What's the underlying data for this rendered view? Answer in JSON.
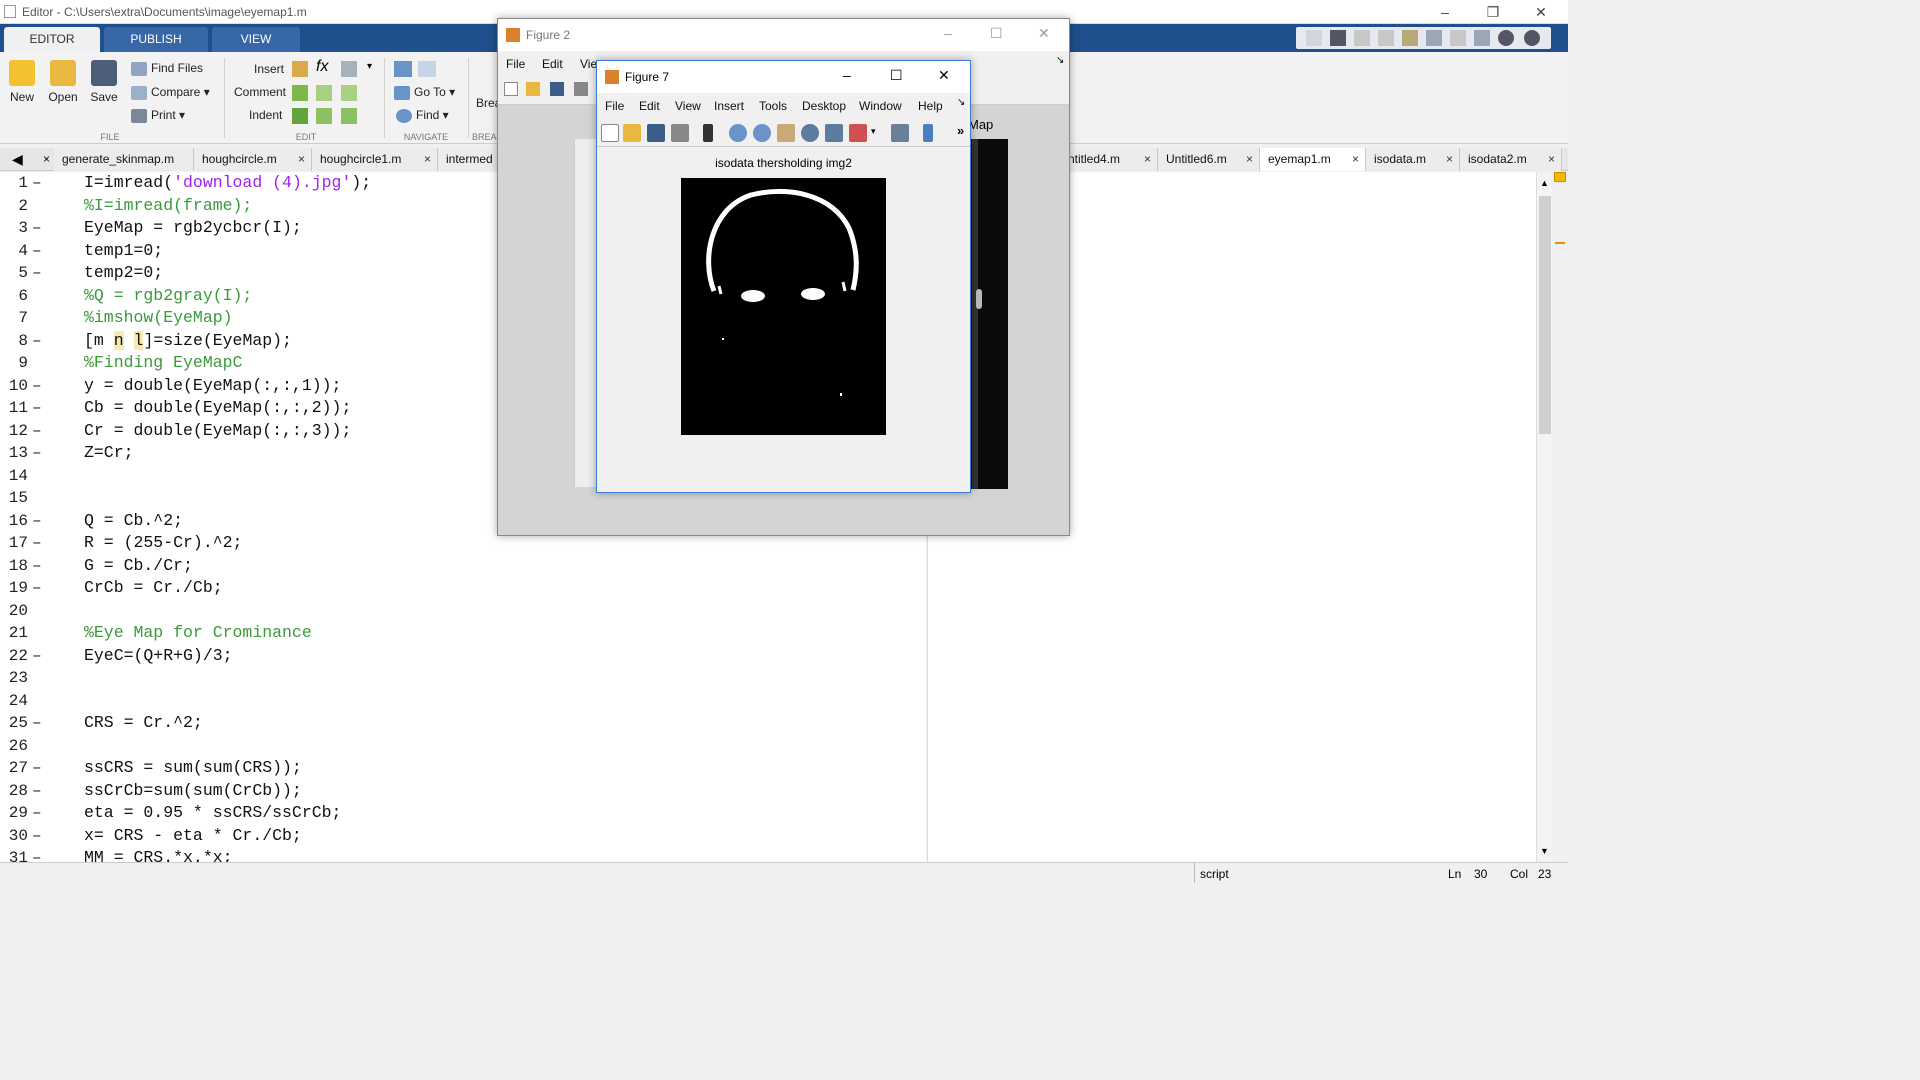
{
  "window": {
    "title": "Editor - C:\\Users\\extra\\Documents\\image\\eyemap1.m"
  },
  "ribbon_tabs": [
    {
      "label": "EDITOR"
    },
    {
      "label": "PUBLISH"
    },
    {
      "label": "VIEW"
    }
  ],
  "ribbon": {
    "new": "New",
    "open": "Open",
    "save": "Save",
    "find_files": "Find Files",
    "compare": "Compare",
    "print": "Print",
    "insert": "Insert",
    "comment": "Comment",
    "indent": "Indent",
    "fx": "fx",
    "go_to": "Go To",
    "find": "Find",
    "breakpoints": "Brea",
    "sections": {
      "file": "FILE",
      "edit": "EDIT",
      "navigate": "NAVIGATE",
      "breakpoints": "BREA"
    }
  },
  "file_tabs": [
    {
      "label": "generate_skinmap.m"
    },
    {
      "label": "houghcircle.m"
    },
    {
      "label": "houghcircle1.m"
    },
    {
      "label": "intermed"
    },
    {
      "label": "ntitled4.m"
    },
    {
      "label": "Untitled6.m"
    },
    {
      "label": "eyemap1.m"
    },
    {
      "label": "isodata.m"
    },
    {
      "label": "isodata2.m"
    }
  ],
  "close_glyph": "×",
  "code_lines": [
    {
      "n": "1",
      "dash": "–",
      "segs": [
        {
          "t": "I=imread(",
          "c": ""
        },
        {
          "t": "'download (4).jpg'",
          "c": "st"
        },
        {
          "t": ");",
          "c": ""
        }
      ]
    },
    {
      "n": "2",
      "dash": "",
      "segs": [
        {
          "t": "%I=imread(frame);",
          "c": "cm"
        }
      ]
    },
    {
      "n": "3",
      "dash": "–",
      "segs": [
        {
          "t": "EyeMap = rgb2ycbcr(I);",
          "c": ""
        }
      ]
    },
    {
      "n": "4",
      "dash": "–",
      "segs": [
        {
          "t": "temp1=0;",
          "c": ""
        }
      ]
    },
    {
      "n": "5",
      "dash": "–",
      "segs": [
        {
          "t": "temp2=0;",
          "c": ""
        }
      ]
    },
    {
      "n": "6",
      "dash": "",
      "segs": [
        {
          "t": "%Q = rgb2gray(I);",
          "c": "cm"
        }
      ]
    },
    {
      "n": "7",
      "dash": "",
      "segs": [
        {
          "t": "%imshow(EyeMap)",
          "c": "cm"
        }
      ]
    },
    {
      "n": "8",
      "dash": "–",
      "segs": [
        {
          "t": "[m ",
          "c": ""
        },
        {
          "t": "n",
          "c": "hl"
        },
        {
          "t": " ",
          "c": ""
        },
        {
          "t": "l",
          "c": "hl"
        },
        {
          "t": "]=size(EyeMap);",
          "c": ""
        }
      ]
    },
    {
      "n": "9",
      "dash": "",
      "segs": [
        {
          "t": "%Finding EyeMapC",
          "c": "cm"
        }
      ]
    },
    {
      "n": "10",
      "dash": "–",
      "segs": [
        {
          "t": "y = double(EyeMap(:,:,1));",
          "c": ""
        }
      ]
    },
    {
      "n": "11",
      "dash": "–",
      "segs": [
        {
          "t": "Cb = double(EyeMap(:,:,2));",
          "c": ""
        }
      ]
    },
    {
      "n": "12",
      "dash": "–",
      "segs": [
        {
          "t": "Cr = double(EyeMap(:,:,3));",
          "c": ""
        }
      ]
    },
    {
      "n": "13",
      "dash": "–",
      "segs": [
        {
          "t": "Z=Cr;",
          "c": ""
        }
      ]
    },
    {
      "n": "14",
      "dash": "",
      "segs": []
    },
    {
      "n": "15",
      "dash": "",
      "segs": []
    },
    {
      "n": "16",
      "dash": "–",
      "segs": [
        {
          "t": "Q = Cb.^2;",
          "c": ""
        }
      ]
    },
    {
      "n": "17",
      "dash": "–",
      "segs": [
        {
          "t": "R = (255-Cr).^2;",
          "c": ""
        }
      ]
    },
    {
      "n": "18",
      "dash": "–",
      "segs": [
        {
          "t": "G = Cb./Cr;",
          "c": ""
        }
      ]
    },
    {
      "n": "19",
      "dash": "–",
      "segs": [
        {
          "t": "CrCb = Cr./Cb;",
          "c": ""
        }
      ]
    },
    {
      "n": "20",
      "dash": "",
      "segs": []
    },
    {
      "n": "21",
      "dash": "",
      "segs": [
        {
          "t": "%Eye Map for Crominance",
          "c": "cm"
        }
      ]
    },
    {
      "n": "22",
      "dash": "–",
      "segs": [
        {
          "t": "EyeC=(Q+R+G)/3;",
          "c": ""
        }
      ]
    },
    {
      "n": "23",
      "dash": "",
      "segs": []
    },
    {
      "n": "24",
      "dash": "",
      "segs": []
    },
    {
      "n": "25",
      "dash": "–",
      "segs": [
        {
          "t": "CRS = Cr.^2;",
          "c": ""
        }
      ]
    },
    {
      "n": "26",
      "dash": "",
      "segs": []
    },
    {
      "n": "27",
      "dash": "–",
      "segs": [
        {
          "t": "ssCRS = sum(sum(CRS));",
          "c": ""
        }
      ]
    },
    {
      "n": "28",
      "dash": "–",
      "segs": [
        {
          "t": "ssCrCb=sum(sum(CrCb));",
          "c": ""
        }
      ]
    },
    {
      "n": "29",
      "dash": "–",
      "segs": [
        {
          "t": "eta = 0.95 * ssCRS/ssCrCb;",
          "c": ""
        }
      ]
    },
    {
      "n": "30",
      "dash": "–",
      "segs": [
        {
          "t": "x= CRS - eta * Cr./Cb;",
          "c": ""
        }
      ]
    },
    {
      "n": "31",
      "dash": "–",
      "segs": [
        {
          "t": "MM = CRS.*x.*x;",
          "c": ""
        }
      ]
    }
  ],
  "status": {
    "mode": "script",
    "ln_label": "Ln",
    "ln": "30",
    "col_label": "Col",
    "col": "23"
  },
  "figure2": {
    "title": "Figure 2",
    "menu": [
      {
        "label": "File"
      },
      {
        "label": "Edit"
      },
      {
        "label": "Vie"
      }
    ],
    "axes_label": "Map"
  },
  "figure7": {
    "title": "Figure 7",
    "menu": [
      {
        "label": "File"
      },
      {
        "label": "Edit"
      },
      {
        "label": "View"
      },
      {
        "label": "Insert"
      },
      {
        "label": "Tools"
      },
      {
        "label": "Desktop"
      },
      {
        "label": "Window"
      },
      {
        "label": "Help"
      }
    ],
    "more": "»",
    "plot_title": "isodata thersholding img2"
  },
  "colors": {
    "ribbon_blue": "#1f4f8c",
    "comment": "#3b9a3b",
    "string": "#a020f0"
  }
}
